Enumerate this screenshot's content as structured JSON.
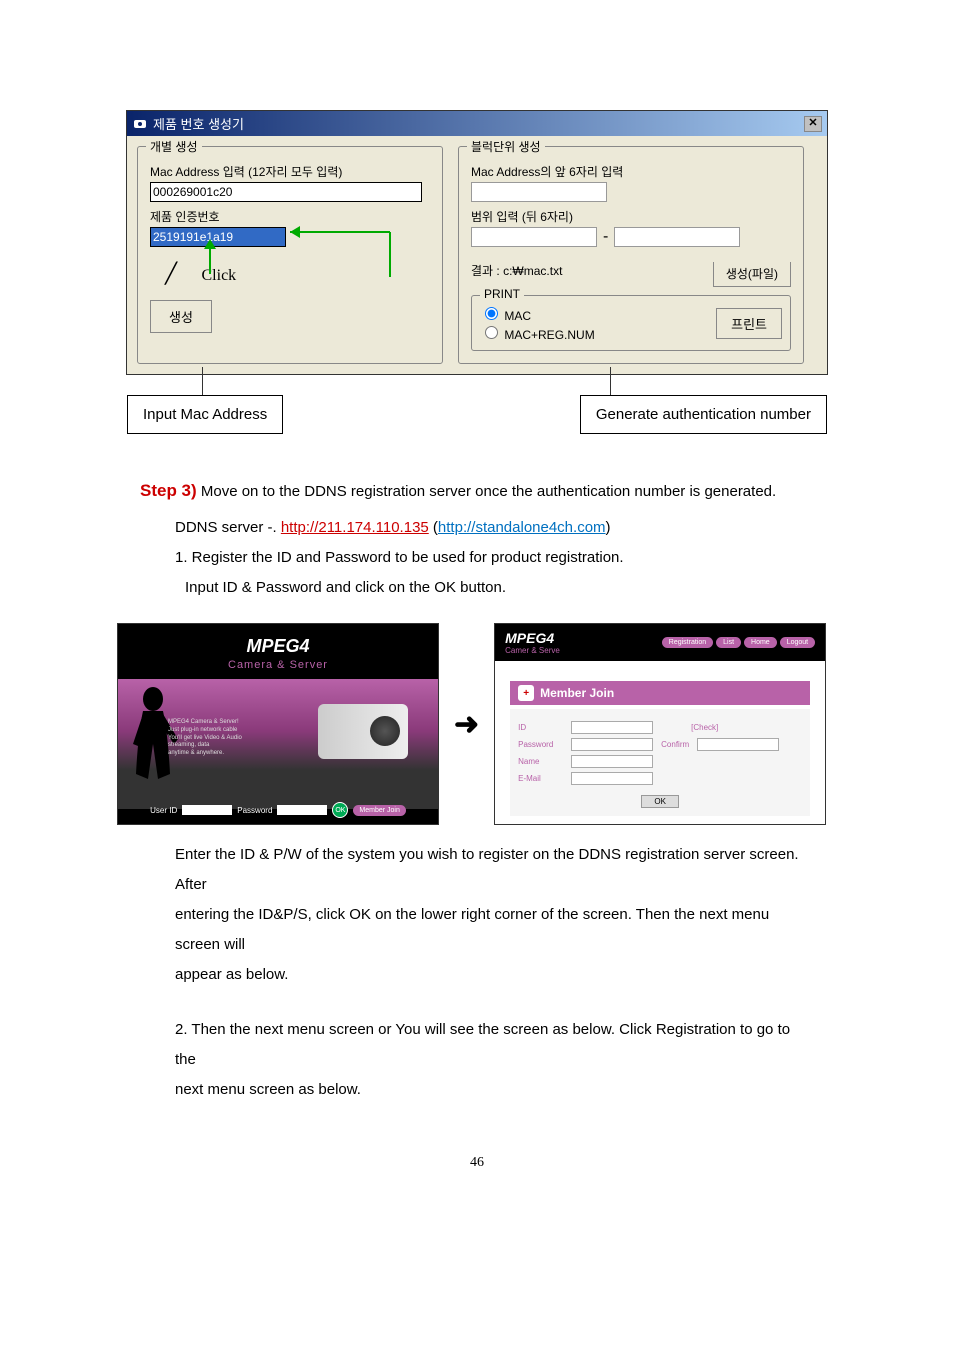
{
  "appWindow": {
    "title": "제품 번호 생성기",
    "leftGroup": {
      "legend": "개별 생성",
      "macLabel": "Mac Address 입력 (12자리 모두 입력)",
      "macValue": "000269001c20",
      "authLabel": "제품 인증번호",
      "authValue": "2519191e1a19",
      "clickText": "Click",
      "genButton": "생성"
    },
    "rightGroup": {
      "legend": "블럭단위 생성",
      "macPrefixLabel": "Mac Address의 앞 6자리 입력",
      "rangeLabel": "범위 입력 (뒤 6자리)",
      "rangeDash": "-",
      "resultLabel": "결과 : c:₩mac.txt",
      "genFileButton": "생성(파일)",
      "printLegend": "PRINT",
      "radioMac": "MAC",
      "radioMacReg": "MAC+REG.NUM",
      "printButton": "프린트"
    }
  },
  "callouts": {
    "inputMac": "Input Mac Address",
    "genAuth": "Generate authentication number"
  },
  "content": {
    "stepLabel": "Step 3)",
    "stepText": " Move on to the DDNS registration server once the authentication number is generated.",
    "ddnsLine": "DDNS server -. ",
    "ddnsUrl1": "http://211.174.110.135",
    "ddnsParen": " (",
    "ddnsUrl2": "http://standalone4ch.com",
    "ddnsClose": ")",
    "item1": "1. Register the ID and Password to be used for product registration.",
    "item1b": "Input ID & Password and click on the OK button.",
    "afterImages1": "Enter the ID & P/W of the system you wish to register on the DDNS registration server screen. After",
    "afterImages2": "entering the ID&P/S, click OK on the lower right corner of the screen. Then the next menu screen will",
    "afterImages3": "appear as below.",
    "item2a": "2. Then the next menu screen or You will see the screen as below. Click Registration to go to the",
    "item2b": "next menu screen as below."
  },
  "screenshots": {
    "logo": "MPEG4",
    "logoSub": "Camera & Server",
    "promo1": "MPEG4 Camera & Server!",
    "promo2": "Just plug-in network cable",
    "promo3": "You'll get live Video & Audio",
    "promo4": "streaming, data",
    "promo5": "anytime & anywhere.",
    "userIdLabel": "User ID",
    "passwordLabel": "Password",
    "memberJoinBtn": "Member Join",
    "nav": {
      "registration": "Registration",
      "list": "List",
      "home": "Home",
      "logout": "Logout"
    },
    "memberJoinTitle": "Member Join",
    "form": {
      "id": "ID",
      "check": "[Check]",
      "password": "Password",
      "confirm": "Confirm",
      "name": "Name",
      "email": "E-Mail",
      "ok": "OK"
    }
  },
  "pageNumber": "46"
}
